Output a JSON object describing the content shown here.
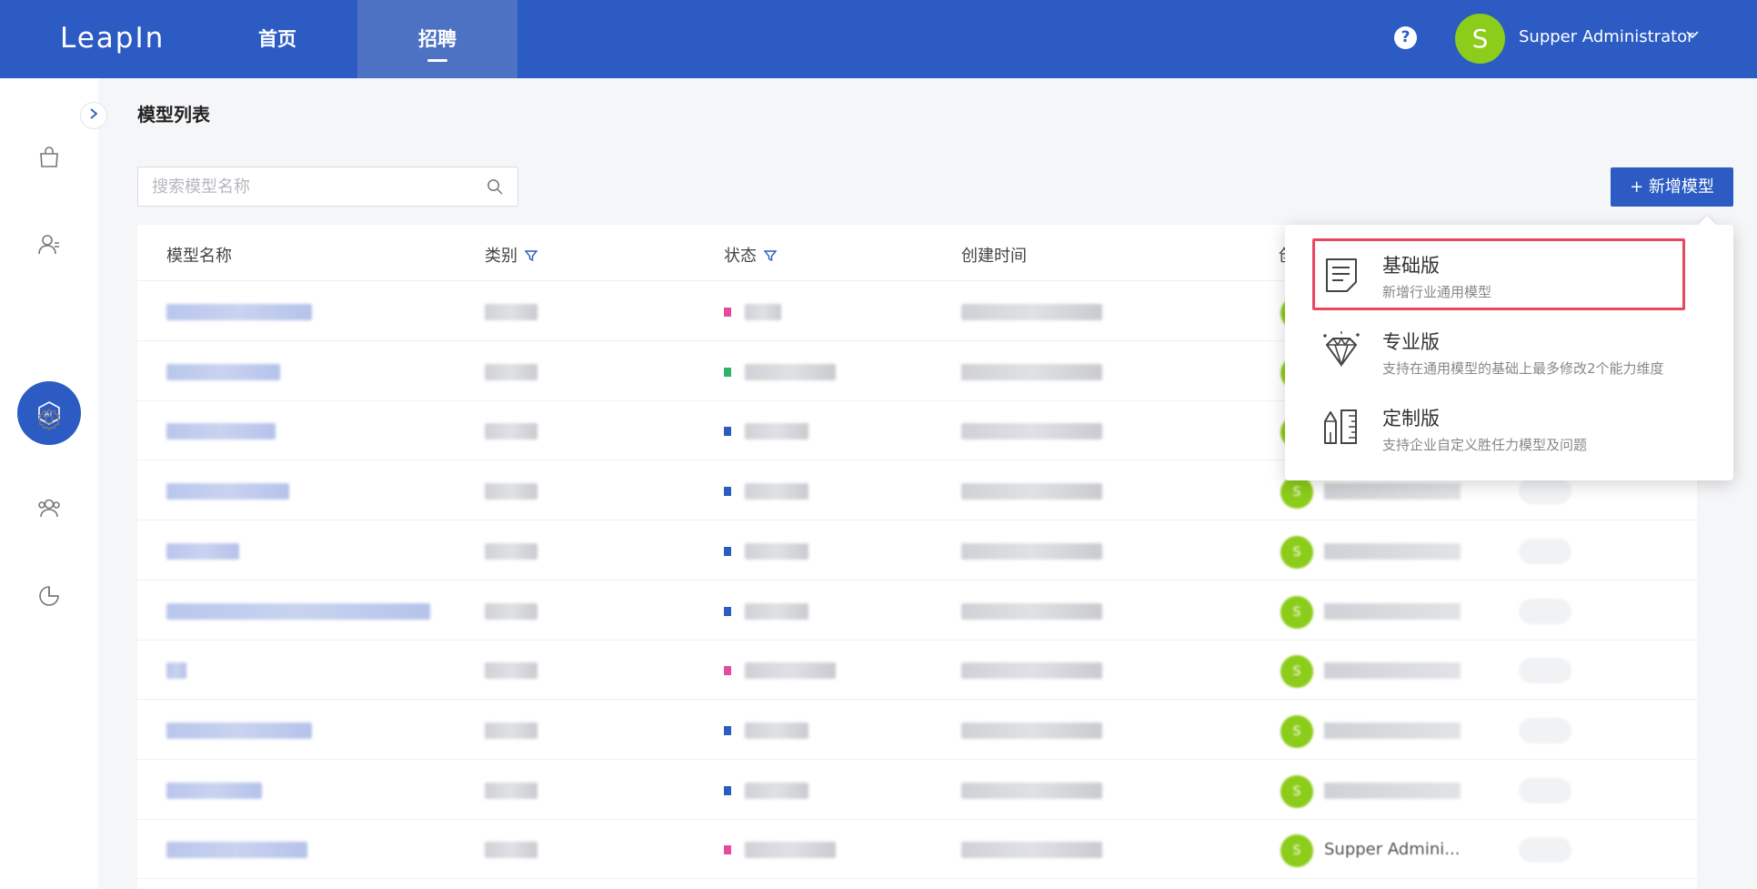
{
  "app": {
    "logo": "LeapIn",
    "nav": [
      {
        "label": "首页"
      },
      {
        "label": "招聘"
      }
    ],
    "help_label": "?",
    "user": {
      "avatar_letter": "S",
      "name": "Supper Administrator"
    }
  },
  "sidebar": {
    "items": [
      {
        "icon": "bag-icon"
      },
      {
        "icon": "user-icon"
      },
      {
        "icon": "ai-icon",
        "label": "AI"
      },
      {
        "icon": "gear-icon"
      },
      {
        "icon": "team-icon"
      },
      {
        "icon": "pie-chart-icon"
      }
    ]
  },
  "page": {
    "title": "模型列表",
    "search_placeholder": "搜索模型名称",
    "add_button": "+ 新增模型"
  },
  "table": {
    "columns": [
      "模型名称",
      "类别",
      "状态",
      "创建时间",
      "创"
    ],
    "rows": [
      {
        "name_w": 160,
        "dot": "#e64a9a",
        "status_w": 40,
        "creator": ""
      },
      {
        "name_w": 125,
        "dot": "#2fb36a",
        "status_w": 100,
        "creator": ""
      },
      {
        "name_w": 120,
        "dot": "#2c5bc4",
        "status_w": 70,
        "creator": ""
      },
      {
        "name_w": 135,
        "dot": "#2c5bc4",
        "status_w": 70,
        "creator": ""
      },
      {
        "name_w": 80,
        "dot": "#2c5bc4",
        "status_w": 70,
        "creator": ""
      },
      {
        "name_w": 290,
        "dot": "#2c5bc4",
        "status_w": 70,
        "creator": ""
      },
      {
        "name_w": 22,
        "dot": "#e64a9a",
        "status_w": 100,
        "creator": ""
      },
      {
        "name_w": 160,
        "dot": "#2c5bc4",
        "status_w": 70,
        "creator": ""
      },
      {
        "name_w": 105,
        "dot": "#2c5bc4",
        "status_w": 70,
        "creator": ""
      },
      {
        "name_w": 155,
        "dot": "#e64a9a",
        "status_w": 100,
        "creator": "Supper Admini..."
      }
    ]
  },
  "dropdown": {
    "options": [
      {
        "title": "基础版",
        "desc": "新增行业通用模型",
        "icon": "document-icon",
        "selected": true
      },
      {
        "title": "专业版",
        "desc": "支持在通用模型的基础上最多修改2个能力维度",
        "icon": "diamond-icon",
        "selected": false
      },
      {
        "title": "定制版",
        "desc": "支持企业自定义胜任力模型及问题",
        "icon": "tools-icon",
        "selected": false
      }
    ]
  },
  "colors": {
    "primary": "#2c5bc4",
    "avatar": "#8ccc1a",
    "highlight": "#e8485f"
  }
}
